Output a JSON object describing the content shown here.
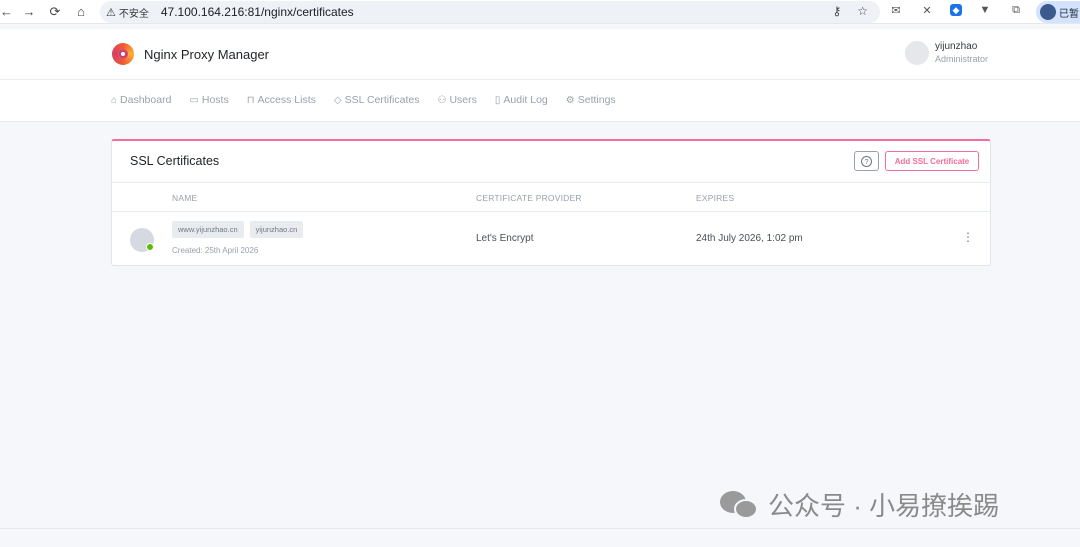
{
  "browser": {
    "security_label": "不安全",
    "url": "47.100.164.216:81/nginx/certificates",
    "profile_label": "已暂"
  },
  "header": {
    "brand": "Nginx Proxy Manager",
    "user_name": "yijunzhao",
    "user_role": "Administrator"
  },
  "nav": {
    "items": [
      {
        "label": "Dashboard",
        "icon": "home-icon"
      },
      {
        "label": "Hosts",
        "icon": "monitor-icon"
      },
      {
        "label": "Access Lists",
        "icon": "lock-icon"
      },
      {
        "label": "SSL Certificates",
        "icon": "shield-icon"
      },
      {
        "label": "Users",
        "icon": "users-icon"
      },
      {
        "label": "Audit Log",
        "icon": "book-icon"
      },
      {
        "label": "Settings",
        "icon": "gear-icon"
      }
    ]
  },
  "card": {
    "title": "SSL Certificates",
    "add_button": "Add SSL Certificate",
    "help_icon": "?",
    "columns": [
      "NAME",
      "CERTIFICATE PROVIDER",
      "EXPIRES"
    ],
    "rows": [
      {
        "domains": [
          "www.yijunzhao.cn",
          "yijunzhao.cn"
        ],
        "created": "Created: 25th April 2026",
        "provider": "Let's Encrypt",
        "expires": "24th July 2026, 1:02 pm",
        "status_color": "#5eba00"
      }
    ]
  },
  "watermark": {
    "text": "公众号 · 小易撩挨踢"
  },
  "colors": {
    "accent": "#f66d9b",
    "status_ok": "#5eba00"
  }
}
